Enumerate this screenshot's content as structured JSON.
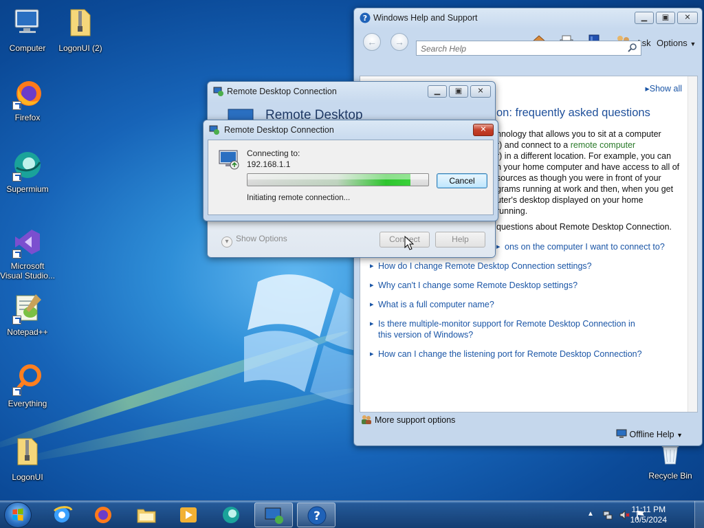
{
  "desktop": {
    "icons": [
      {
        "label": "Computer"
      },
      {
        "label": "LogonUI (2)"
      },
      {
        "label": "Firefox"
      },
      {
        "label": "Supermium"
      },
      {
        "label": "Microsoft Visual Studio..."
      },
      {
        "label": "Notepad++"
      },
      {
        "label": "Everything"
      },
      {
        "label": "LogonUI"
      },
      {
        "label": "Recycle Bin"
      }
    ]
  },
  "help_window": {
    "title": "Windows Help and Support",
    "ask_label": "Ask",
    "options_label": "Options",
    "search_placeholder": "Search Help",
    "show_all": "Show all",
    "heading": "on: frequently asked questions",
    "para_1": "hnology that allows you to sit at a computer",
    "para_2a": "r) and connect to a ",
    "para_2_link": "remote computer",
    "para_3": "r) in a different location. For example, you can",
    "para_4": "n your home computer and have access to all of",
    "para_5": "sources as though you were in front of your",
    "para_6": "grams running at work and then, when you get",
    "para_7": "uter's desktop displayed on your home",
    "para_8": "running.",
    "questions_intro": "questions about Remote Desktop Connection.",
    "faqs": [
      "ons on the computer I want to connect to?",
      "How do I change Remote Desktop Connection settings?",
      "Why can't I change some Remote Desktop settings?",
      "What is a full computer name?",
      "Is there multiple-monitor support for Remote Desktop Connection in this version of Windows?",
      "How can I change the listening port for Remote Desktop Connection?"
    ],
    "more_support": "More support options",
    "offline_help": "Offline Help"
  },
  "rdc_main": {
    "title": "Remote Desktop Connection",
    "banner_title": "Remote Desktop",
    "show_options": "Show Options",
    "connect_label": "Connect",
    "help_label": "Help"
  },
  "rdc_dialog": {
    "title": "Remote Desktop Connection",
    "connecting_to": "Connecting to:",
    "ip": "192.168.1.1",
    "cancel_label": "Cancel",
    "status": "Initiating remote connection...",
    "progress": 0.9
  },
  "taskbar": {
    "time": "11:11 PM",
    "date": "10/5/2024"
  },
  "colors": {
    "link": "#1a55a6",
    "green_link": "#2a7a2a",
    "progress_green": "#2ec52e"
  }
}
